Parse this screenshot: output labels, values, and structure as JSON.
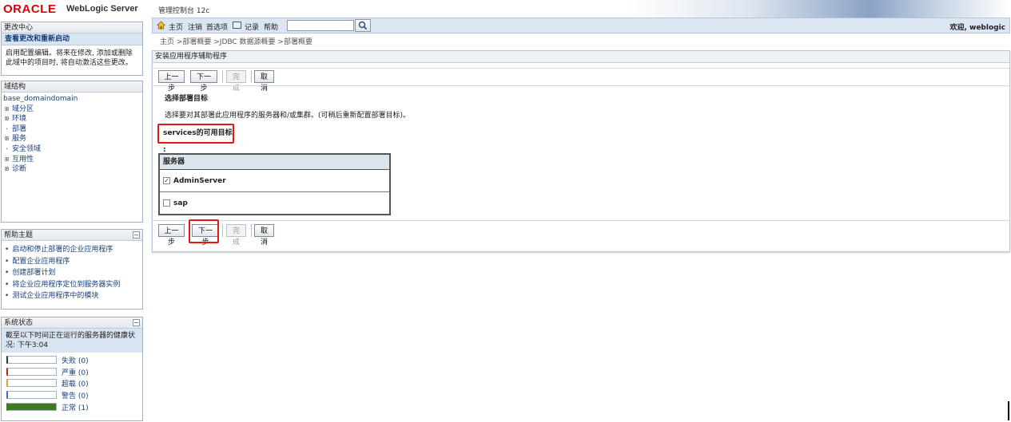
{
  "header": {
    "logo_text": "ORACLE",
    "product_name": "WebLogic Server",
    "product_sub": "管理控制台 12c"
  },
  "change_center": {
    "title": "更改中心",
    "view_changes": "查看更改和重新启动",
    "description": "启用配置编辑。将来在修改, 添加或删除此域中的项目时, 将自动激活这些更改。"
  },
  "domain_structure": {
    "title": "域结构",
    "root": "base_domaindomain",
    "items": [
      {
        "toggle": "⊞",
        "label": "域分区"
      },
      {
        "toggle": "⊞",
        "label": "环境"
      },
      {
        "toggle": "·",
        "label": "部署"
      },
      {
        "toggle": "⊞",
        "label": "服务"
      },
      {
        "toggle": "·",
        "label": "安全领域"
      },
      {
        "toggle": "⊞",
        "label": "互用性"
      },
      {
        "toggle": "⊞",
        "label": "诊断"
      }
    ]
  },
  "help_topics": {
    "title": "帮助主题",
    "items": [
      "启动和停止部署的企业应用程序",
      "配置企业应用程序",
      "创建部署计划",
      "将企业应用程序定位到服务器实例",
      "测试企业应用程序中的模块"
    ]
  },
  "system_status": {
    "title": "系统状态",
    "description": "截至以下时间正在运行的服务器的健康状况: 下午3:04",
    "rows": [
      {
        "label": "失败 (0)",
        "color": "#333333",
        "fraction": 0
      },
      {
        "label": "严重 (0)",
        "color": "#d01818",
        "fraction": 0
      },
      {
        "label": "超载 (0)",
        "color": "#d6a020",
        "fraction": 0
      },
      {
        "label": "警告 (0)",
        "color": "#3a6fb0",
        "fraction": 0
      },
      {
        "label": "正常 (1)",
        "color": "#3e7a1e",
        "fraction": 1
      }
    ]
  },
  "toolbar": {
    "home": "主页",
    "logout": "注销",
    "preferences": "首选项",
    "record": "记录",
    "help": "帮助",
    "search_value": "",
    "welcome": "欢迎, weblogic"
  },
  "breadcrumb": "主页 >部署概要 >JDBC 数据源概要 >部署概要",
  "wizard": {
    "title": "安装应用程序辅助程序",
    "back": "上一步",
    "next": "下一步",
    "finish": "完成",
    "cancel": "取消",
    "step_title": "选择部署目标",
    "step_desc": "选择要对其部署此应用程序的服务器和/或集群。(可稍后重新配置部署目标)。",
    "targets_label": "services的可用目标 :",
    "table_header": "服务器",
    "servers": [
      {
        "name": "AdminServer",
        "checked": true
      },
      {
        "name": "sap",
        "checked": false
      }
    ]
  }
}
